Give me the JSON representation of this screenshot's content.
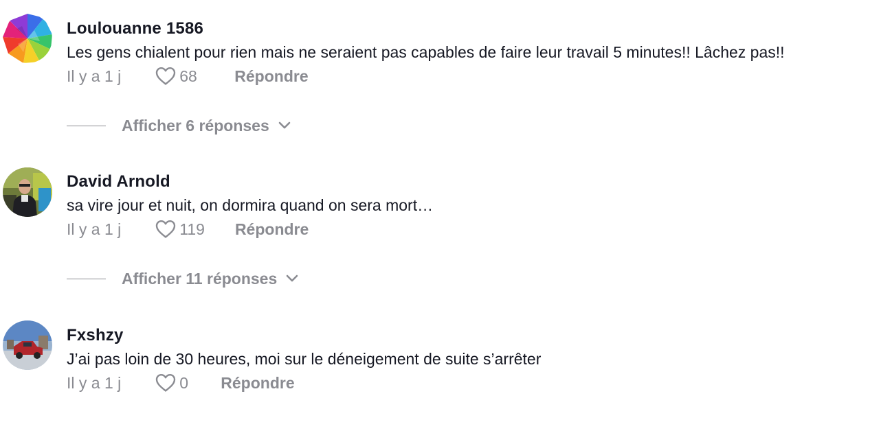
{
  "comments": [
    {
      "username": "Loulouanne 1586",
      "text": "Les gens chialent pour rien mais ne seraient pas capables de faire leur travail 5 minutes!! Lâchez pas!!",
      "time": "Il y a 1 j",
      "likes": "68",
      "reply_label": "Répondre",
      "view_replies": "Afficher 6 réponses",
      "avatar_icon": "rainbow-polygon-avatar"
    },
    {
      "username": "David Arnold",
      "text": "sa vire jour et nuit, on dormira quand on sera mort…",
      "time": "Il y a 1 j",
      "likes": "119",
      "reply_label": "Répondre",
      "view_replies": "Afficher 11 réponses",
      "avatar_icon": "person-photo-avatar"
    },
    {
      "username": "Fxshzy",
      "text": "J’ai pas loin de 30 heures, moi sur le déneigement de suite s’arrêter",
      "time": "Il y a 1 j",
      "likes": "0",
      "reply_label": "Répondre",
      "avatar_icon": "truck-photo-avatar"
    }
  ],
  "colors": {
    "text_primary": "#161823",
    "text_secondary": "#8a8b91",
    "background": "#ffffff"
  }
}
